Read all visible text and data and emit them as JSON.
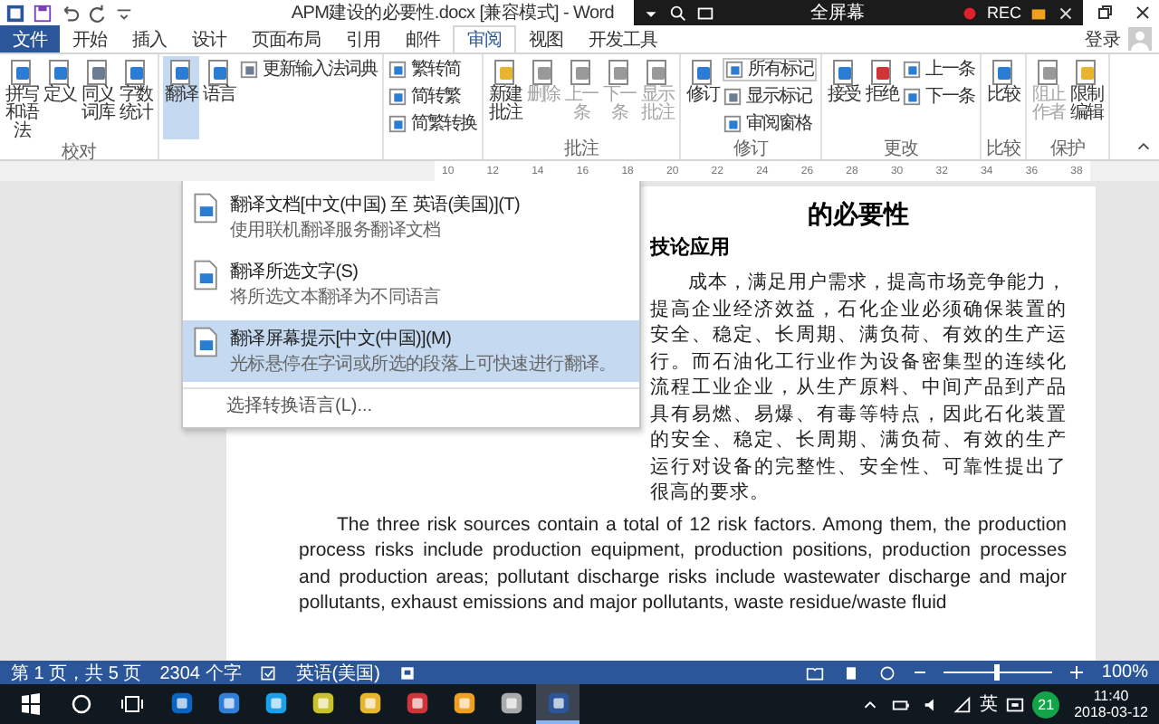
{
  "title_bar": {
    "title": "APM建设的必要性.docx [兼容模式] - Word",
    "sign_in": "登录"
  },
  "recorder": {
    "label": "全屏幕",
    "rec": "REC"
  },
  "tabs": [
    {
      "label": "文件",
      "kind": "file",
      "selected": false
    },
    {
      "label": "开始",
      "kind": "tab",
      "selected": false
    },
    {
      "label": "插入",
      "kind": "tab",
      "selected": false
    },
    {
      "label": "设计",
      "kind": "tab",
      "selected": false
    },
    {
      "label": "页面布局",
      "kind": "tab",
      "selected": false
    },
    {
      "label": "引用",
      "kind": "tab",
      "selected": false
    },
    {
      "label": "邮件",
      "kind": "tab",
      "selected": false
    },
    {
      "label": "审阅",
      "kind": "tab",
      "selected": true
    },
    {
      "label": "视图",
      "kind": "tab",
      "selected": false
    },
    {
      "label": "开发工具",
      "kind": "tab",
      "selected": false
    }
  ],
  "ribbon": {
    "groups": [
      {
        "label": "校对",
        "items": [
          {
            "kind": "big",
            "label": "拼写和语法",
            "disabled": false,
            "selected": false
          },
          {
            "kind": "big",
            "label": "定义",
            "disabled": false,
            "selected": false
          },
          {
            "kind": "big",
            "label": "同义词库",
            "disabled": false,
            "selected": false
          },
          {
            "kind": "big",
            "label": "字数统计",
            "disabled": false,
            "selected": false
          }
        ]
      },
      {
        "items": [
          {
            "kind": "big",
            "label": "翻译",
            "disabled": false,
            "selected": true
          },
          {
            "kind": "big",
            "label": "语言",
            "disabled": false,
            "selected": false
          },
          {
            "kind": "small",
            "label": "更新输入法词典",
            "disabled": false,
            "selected": false
          }
        ]
      },
      {
        "items": [
          {
            "kind": "small",
            "label": "繁转简",
            "disabled": false,
            "selected": false
          },
          {
            "kind": "small",
            "label": "简转繁",
            "disabled": false,
            "selected": false
          },
          {
            "kind": "small",
            "label": "简繁转换",
            "disabled": false,
            "selected": false
          }
        ]
      },
      {
        "label": "批注",
        "items": [
          {
            "kind": "big",
            "label": "新建批注",
            "disabled": false,
            "selected": false
          },
          {
            "kind": "big",
            "label": "删除",
            "disabled": true,
            "selected": false
          },
          {
            "kind": "big",
            "label": "上一条",
            "disabled": true,
            "selected": false
          },
          {
            "kind": "big",
            "label": "下一条",
            "disabled": true,
            "selected": false
          },
          {
            "kind": "big",
            "label": "显示批注",
            "disabled": true,
            "selected": false
          }
        ]
      },
      {
        "label": "修订",
        "items": [
          {
            "kind": "big",
            "label": "修订",
            "disabled": false,
            "selected": false
          },
          {
            "kind": "dropdown",
            "label": "所有标记",
            "disabled": false,
            "selected": false
          },
          {
            "kind": "small",
            "label": "显示标记",
            "disabled": false,
            "selected": false
          },
          {
            "kind": "small",
            "label": "审阅窗格",
            "disabled": false,
            "selected": false
          }
        ]
      },
      {
        "label": "更改",
        "items": [
          {
            "kind": "big",
            "label": "接受",
            "disabled": false,
            "selected": false
          },
          {
            "kind": "big",
            "label": "拒绝",
            "disabled": false,
            "selected": false
          },
          {
            "kind": "small",
            "label": "上一条",
            "disabled": false,
            "selected": false
          },
          {
            "kind": "small",
            "label": "下一条",
            "disabled": false,
            "selected": false
          }
        ]
      },
      {
        "label": "比较",
        "items": [
          {
            "kind": "big",
            "label": "比较",
            "disabled": false,
            "selected": false
          }
        ]
      },
      {
        "label": "保护",
        "items": [
          {
            "kind": "big",
            "label": "阻止作者",
            "disabled": true,
            "selected": false
          },
          {
            "kind": "big",
            "label": "限制编辑",
            "disabled": false,
            "selected": false
          }
        ]
      }
    ]
  },
  "translate_menu": {
    "items": [
      {
        "title": "翻译文档[中文(中国) 至 英语(美国)](T)",
        "description": "使用联机翻译服务翻译文档",
        "selected": false
      },
      {
        "title": "翻译所选文字(S)",
        "description": "将所选文本翻译为不同语言",
        "selected": false
      },
      {
        "title": "翻译屏幕提示[中文(中国)](M)",
        "description": "光标悬停在字词或所选的段落上可快速进行翻译。",
        "selected": true
      }
    ],
    "footer": "选择转换语言(L)..."
  },
  "ruler": [
    "10",
    "12",
    "14",
    "16",
    "18",
    "20",
    "22",
    "24",
    "26",
    "28",
    "30",
    "32",
    "34",
    "36",
    "38"
  ],
  "document": {
    "heading": "的必要性",
    "subheading": "技论应用",
    "paragraphs": [
      "成本，满足用户需求，提高市场竞争能力，提高企业经济效益，石化企业必须确保装置的安全、稳定、长周期、满负荷、有效的生产运行。而石油化工行业作为设备密集型的连续化流程工业企业，从生产原料、中间产品到产品具有易燃、易爆、有毒等特点，因此石化装置的安全、稳定、长周期、满负荷、有效的生产运行对设备的完整性、安全性、可靠性提出了很高的要求。",
      "The three risk sources contain a total of 12 risk factors. Among them, the production process risks include production equipment, production positions, production processes and production areas; pollutant discharge risks include wastewater discharge and major pollutants, exhaust emissions and major pollutants, waste residue/waste fluid"
    ]
  },
  "status_bar": {
    "page": "第 1 页，共 5 页",
    "words": "2304 个字",
    "language": "英语(美国)",
    "zoom": "100%",
    "level": 0.5
  },
  "taskbar": {
    "apps": [
      {
        "selected": false
      },
      {
        "selected": false
      },
      {
        "selected": false
      },
      {
        "selected": false
      },
      {
        "selected": false
      },
      {
        "selected": false
      },
      {
        "selected": false
      },
      {
        "selected": false
      },
      {
        "selected": true
      }
    ],
    "ime": "英",
    "badge": "21",
    "time": "11:40",
    "date": "2018-03-12"
  }
}
